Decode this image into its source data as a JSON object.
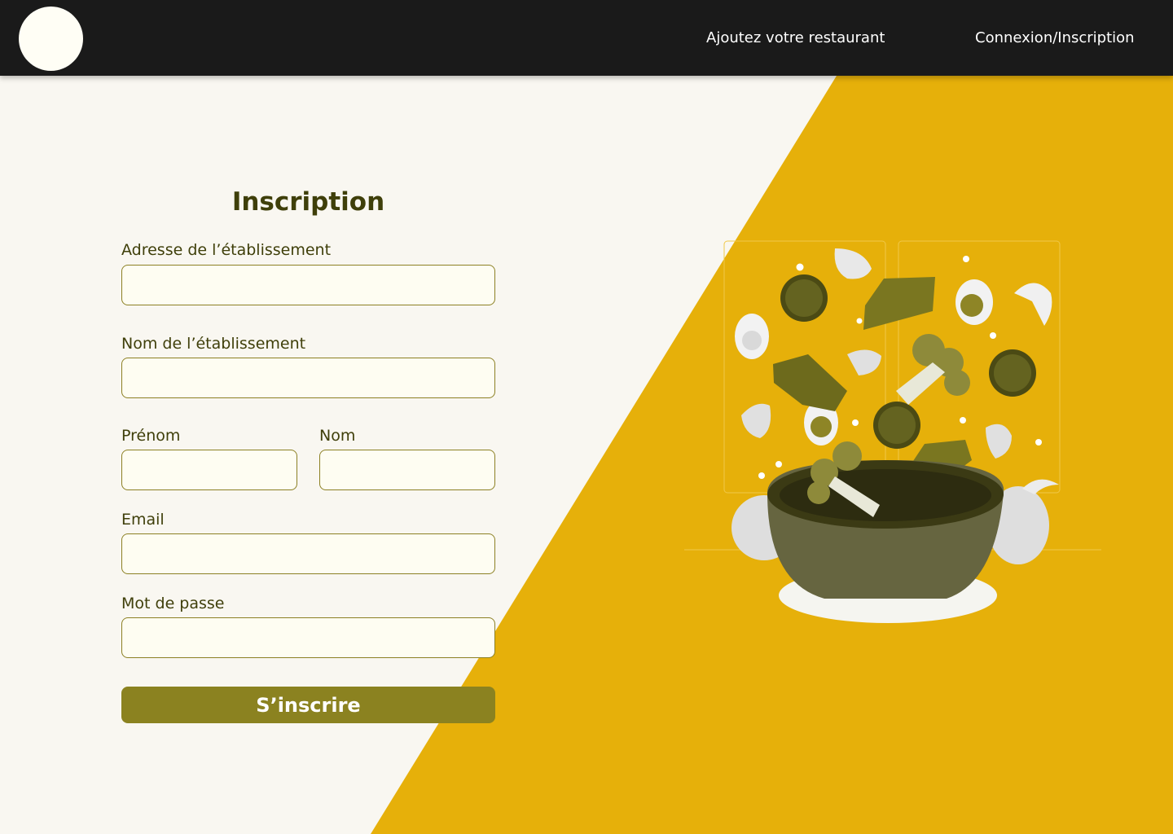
{
  "colors": {
    "topbar": "#1a1a1a",
    "page_background": "#f9f7f1",
    "accent_yellow": "#e6b00a",
    "title_text": "#3f3f0a",
    "input_border": "#8c8024",
    "input_fill": "#fefdf2",
    "button": "#8b8220"
  },
  "header": {
    "logo_icon": "circle-logo",
    "nav": {
      "add_restaurant": "Ajoutez votre restaurant",
      "login_signup": "Connexion/Inscription"
    }
  },
  "form": {
    "title": "Inscription",
    "fields": {
      "address": {
        "label": "Adresse de l’établissement",
        "value": ""
      },
      "business_name": {
        "label": "Nom de l’établissement",
        "value": ""
      },
      "first_name": {
        "label": "Prénom",
        "value": ""
      },
      "last_name": {
        "label": "Nom",
        "value": ""
      },
      "email": {
        "label": "Email",
        "value": ""
      },
      "password": {
        "label": "Mot de passe",
        "value": ""
      }
    },
    "submit_label": "S’inscrire"
  },
  "illustration": {
    "icon": "salad-bowl-illustration"
  }
}
